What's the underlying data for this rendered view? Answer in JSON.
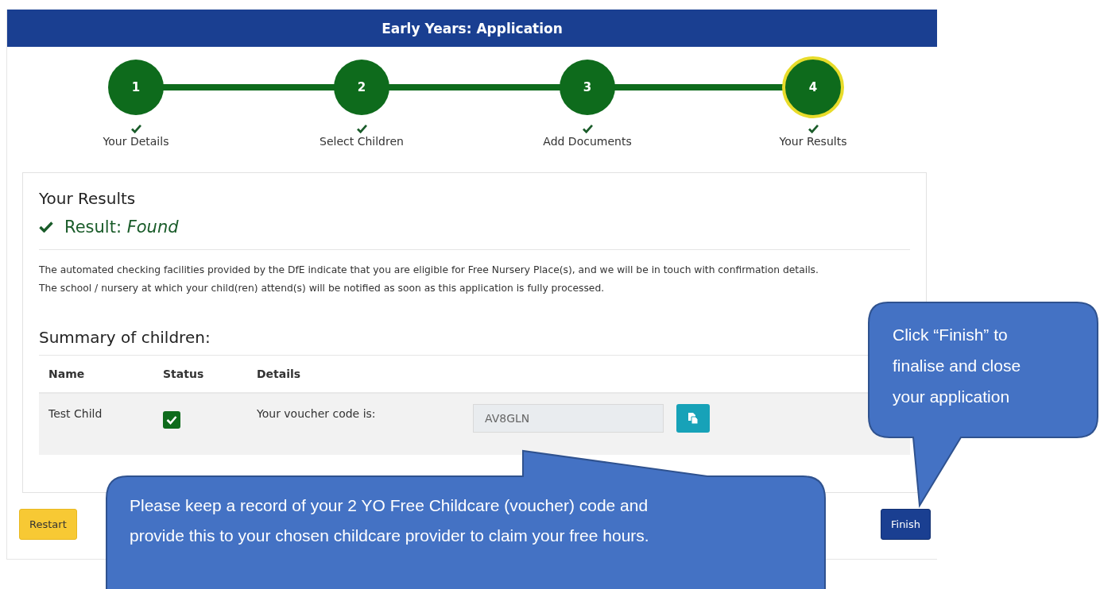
{
  "header": {
    "title": "Early Years: Application"
  },
  "steps": [
    {
      "number": "1",
      "label": "Your Details",
      "completed": true,
      "selected": false
    },
    {
      "number": "2",
      "label": "Select Children",
      "completed": true,
      "selected": false
    },
    {
      "number": "3",
      "label": "Add Documents",
      "completed": true,
      "selected": false
    },
    {
      "number": "4",
      "label": "Your Results",
      "completed": true,
      "selected": true
    }
  ],
  "results": {
    "heading": "Your Results",
    "result_label": "Result:",
    "result_value": "Found",
    "message": [
      "The automated checking facilities provided by the DfE indicate that you are eligible for Free Nursery Place(s), and we will be in touch with confirmation details.",
      "The school / nursery at which your child(ren) attend(s) will be notified as soon as this application is fully processed."
    ]
  },
  "summary": {
    "heading": "Summary of children:",
    "columns": [
      "Name",
      "Status",
      "Details"
    ],
    "rows": [
      {
        "name": "Test Child",
        "checked": true,
        "details": "Your voucher code is:",
        "code": "AV8GLN"
      }
    ]
  },
  "buttons": {
    "restart": "Restart",
    "finish": "Finish"
  },
  "callouts": [
    {
      "text": "Click “Finish” to finalise and close your application"
    },
    {
      "text": "Please keep a record of your 2 YO Free Childcare (voucher) code  and provide this to your chosen childcare provider to claim your free hours."
    }
  ]
}
